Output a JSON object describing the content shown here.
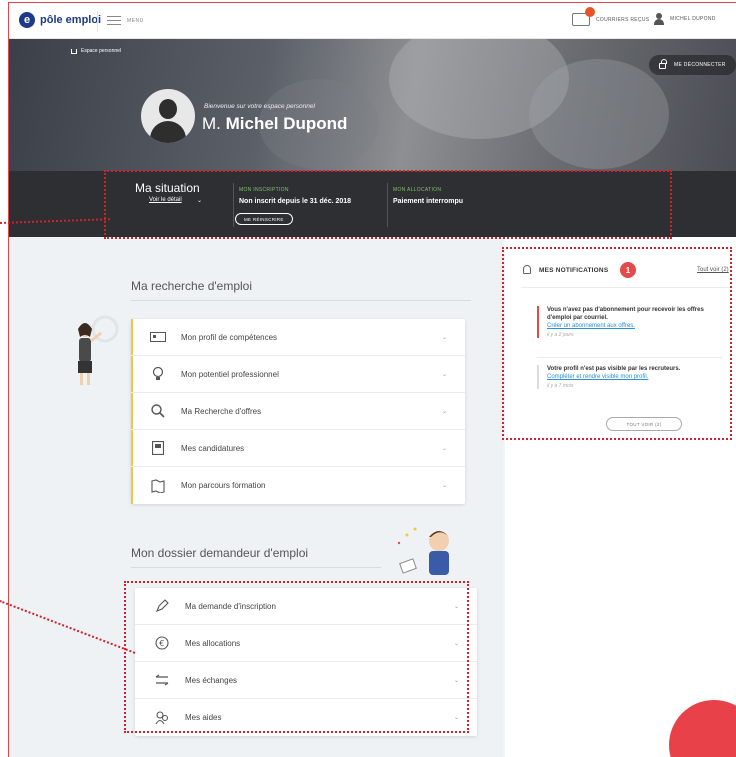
{
  "topbar": {
    "logo_text": "pôle emploi",
    "menu_label": "MENU",
    "mail_label": "COURRIERS REÇUS",
    "user_label": "MICHEL DUPOND"
  },
  "hero": {
    "breadcrumb": "Espace personnel",
    "logout_label": "ME DÉCONNECTER",
    "welcome": "Bienvenue sur votre espace personnel",
    "title_prefix": "M. ",
    "name": "Michel Dupond"
  },
  "situation": {
    "title": "Ma situation",
    "detail_link": "Voir le détail",
    "inscription_label": "MON INSCRIPTION",
    "inscription_value": "Non inscrit depuis le 31 déc. 2018",
    "reinscrire_label": "ME RÉINSCRIRE",
    "allocation_label": "MON ALLOCATION",
    "allocation_value": "Paiement interrompu"
  },
  "recherche": {
    "title": "Ma recherche d'emploi",
    "items": [
      {
        "label": "Mon profil de compétences",
        "icon": "id-card-icon"
      },
      {
        "label": "Mon potentiel professionnel",
        "icon": "lightbulb-icon"
      },
      {
        "label": "Ma Recherche d'offres",
        "icon": "search-icon"
      },
      {
        "label": "Mes candidatures",
        "icon": "document-icon"
      },
      {
        "label": "Mon parcours formation",
        "icon": "map-icon"
      }
    ]
  },
  "dossier": {
    "title": "Mon dossier demandeur d'emploi",
    "items": [
      {
        "label": "Ma demande d'inscription",
        "icon": "pen-icon"
      },
      {
        "label": "Mes allocations",
        "icon": "euro-icon"
      },
      {
        "label": "Mes échanges",
        "icon": "arrows-exchange-icon"
      },
      {
        "label": "Mes aides",
        "icon": "people-icon"
      }
    ]
  },
  "notifications": {
    "title": "MES NOTIFICATIONS",
    "count": "1",
    "see_all_link": "Tout voir (2)",
    "items": [
      {
        "message": "Vous n'avez pas d'abonnement pour recevoir les offres d'emploi par courriel.",
        "link": "Créer un abonnement aux offres.",
        "time": "il y a 2 jours"
      },
      {
        "message": "Votre profil n'est pas visible par les recruteurs.",
        "link": "Compléter et rendre visible mon profil.",
        "time": "il y a 7 mois"
      }
    ],
    "button_label": "TOUT VOIR (2)"
  },
  "colors": {
    "brand": "#1d3a8a",
    "accent_red": "#e34a4a",
    "link_blue": "#2a8fd4",
    "highlight_dots": "#d0222a"
  }
}
